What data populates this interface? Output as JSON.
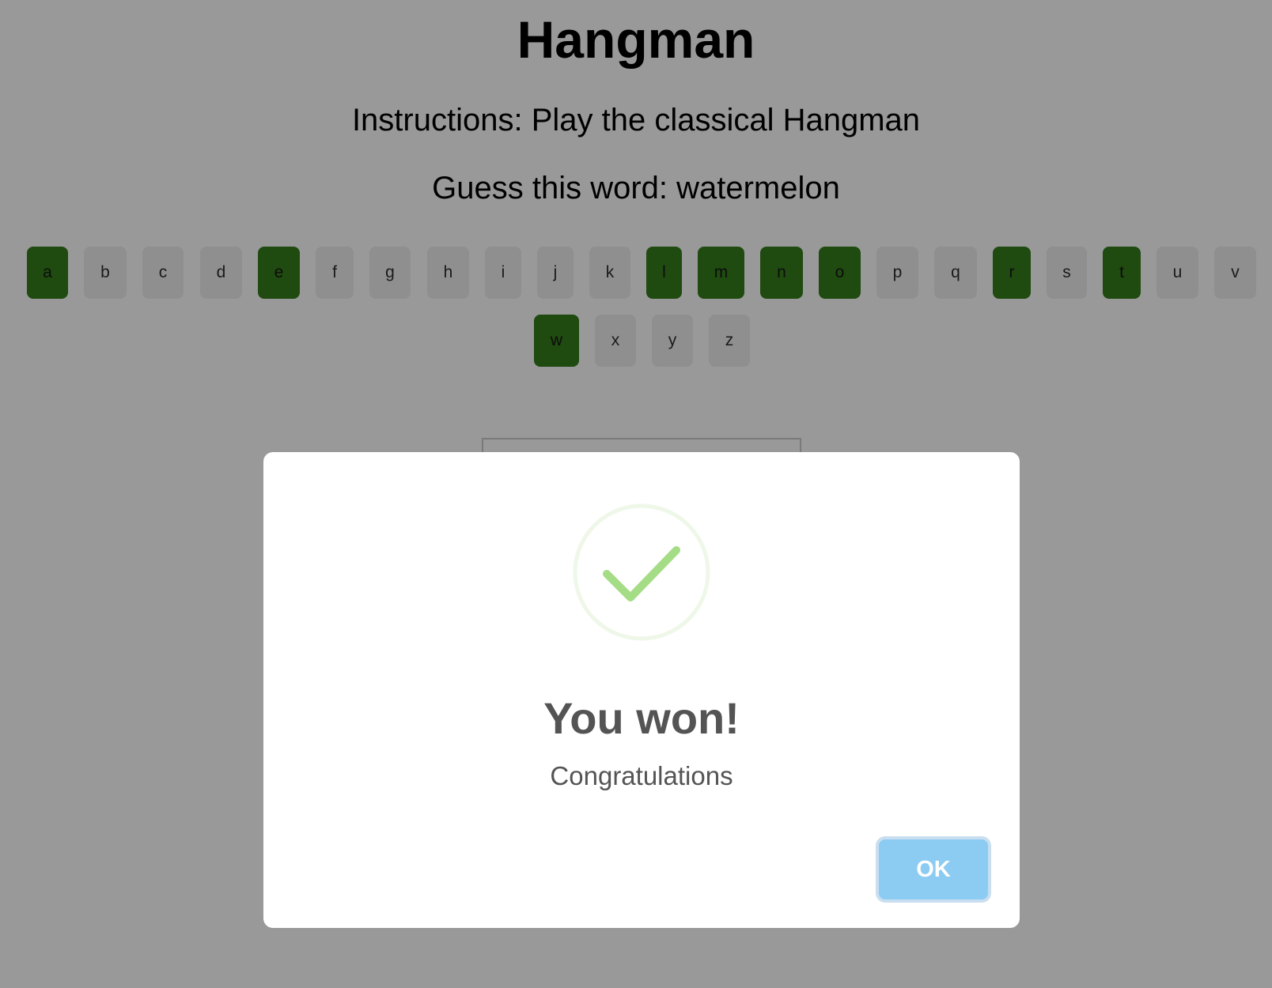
{
  "header": {
    "title": "Hangman",
    "instructions": "Instructions: Play the classical Hangman",
    "guess": "Guess this word: watermelon"
  },
  "keyboard": {
    "row1": [
      {
        "letter": "a",
        "used": true
      },
      {
        "letter": "b",
        "used": false
      },
      {
        "letter": "c",
        "used": false
      },
      {
        "letter": "d",
        "used": false
      },
      {
        "letter": "e",
        "used": true
      },
      {
        "letter": "f",
        "used": false
      },
      {
        "letter": "g",
        "used": false
      },
      {
        "letter": "h",
        "used": false
      },
      {
        "letter": "i",
        "used": false
      },
      {
        "letter": "j",
        "used": false
      },
      {
        "letter": "k",
        "used": false
      },
      {
        "letter": "l",
        "used": true
      },
      {
        "letter": "m",
        "used": true
      },
      {
        "letter": "n",
        "used": true
      },
      {
        "letter": "o",
        "used": true
      },
      {
        "letter": "p",
        "used": false
      },
      {
        "letter": "q",
        "used": false
      },
      {
        "letter": "r",
        "used": true
      },
      {
        "letter": "s",
        "used": false
      },
      {
        "letter": "t",
        "used": true
      },
      {
        "letter": "u",
        "used": false
      },
      {
        "letter": "v",
        "used": false
      }
    ],
    "row2": [
      {
        "letter": "w",
        "used": true
      },
      {
        "letter": "x",
        "used": false
      },
      {
        "letter": "y",
        "used": false
      },
      {
        "letter": "z",
        "used": false
      }
    ]
  },
  "dialog": {
    "icon": "success-check-icon",
    "icon_color": "#a5dc86",
    "title": "You won!",
    "text": "Congratulations",
    "ok_label": "OK",
    "ok_color": "#8cccf3"
  },
  "colors": {
    "overlay_background": "#999999",
    "used_key": "#1f4a10",
    "unused_key": "#8f8f8f"
  }
}
